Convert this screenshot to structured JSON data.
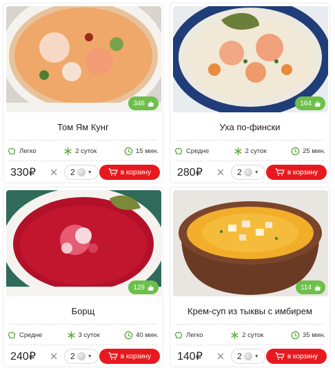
{
  "currency": "₽",
  "like_icon": "thumbs-up-icon",
  "cart_label": "в корзину",
  "items": [
    {
      "title": "Том Ям Кунг",
      "likes": "346",
      "difficulty": "Легко",
      "shelf_life": "2 суток",
      "time": "15 мин.",
      "price": "330₽",
      "qty": "2"
    },
    {
      "title": "Уха по-фински",
      "likes": "164",
      "difficulty": "Средне",
      "shelf_life": "2 суток",
      "time": "25 мин.",
      "price": "280₽",
      "qty": "2"
    },
    {
      "title": "Борщ",
      "likes": "129",
      "difficulty": "Средне",
      "shelf_life": "3 суток",
      "time": "40 мин.",
      "price": "240₽",
      "qty": "2"
    },
    {
      "title": "Крем-суп из тыквы с имбирем",
      "likes": "114",
      "difficulty": "Легко",
      "shelf_life": "2 суток",
      "time": "35 мин.",
      "price": "140₽",
      "qty": "2"
    }
  ],
  "colors": {
    "accent_red": "#e8191e",
    "like_green": "#6cc04a",
    "icon_green": "#5aa83a"
  }
}
